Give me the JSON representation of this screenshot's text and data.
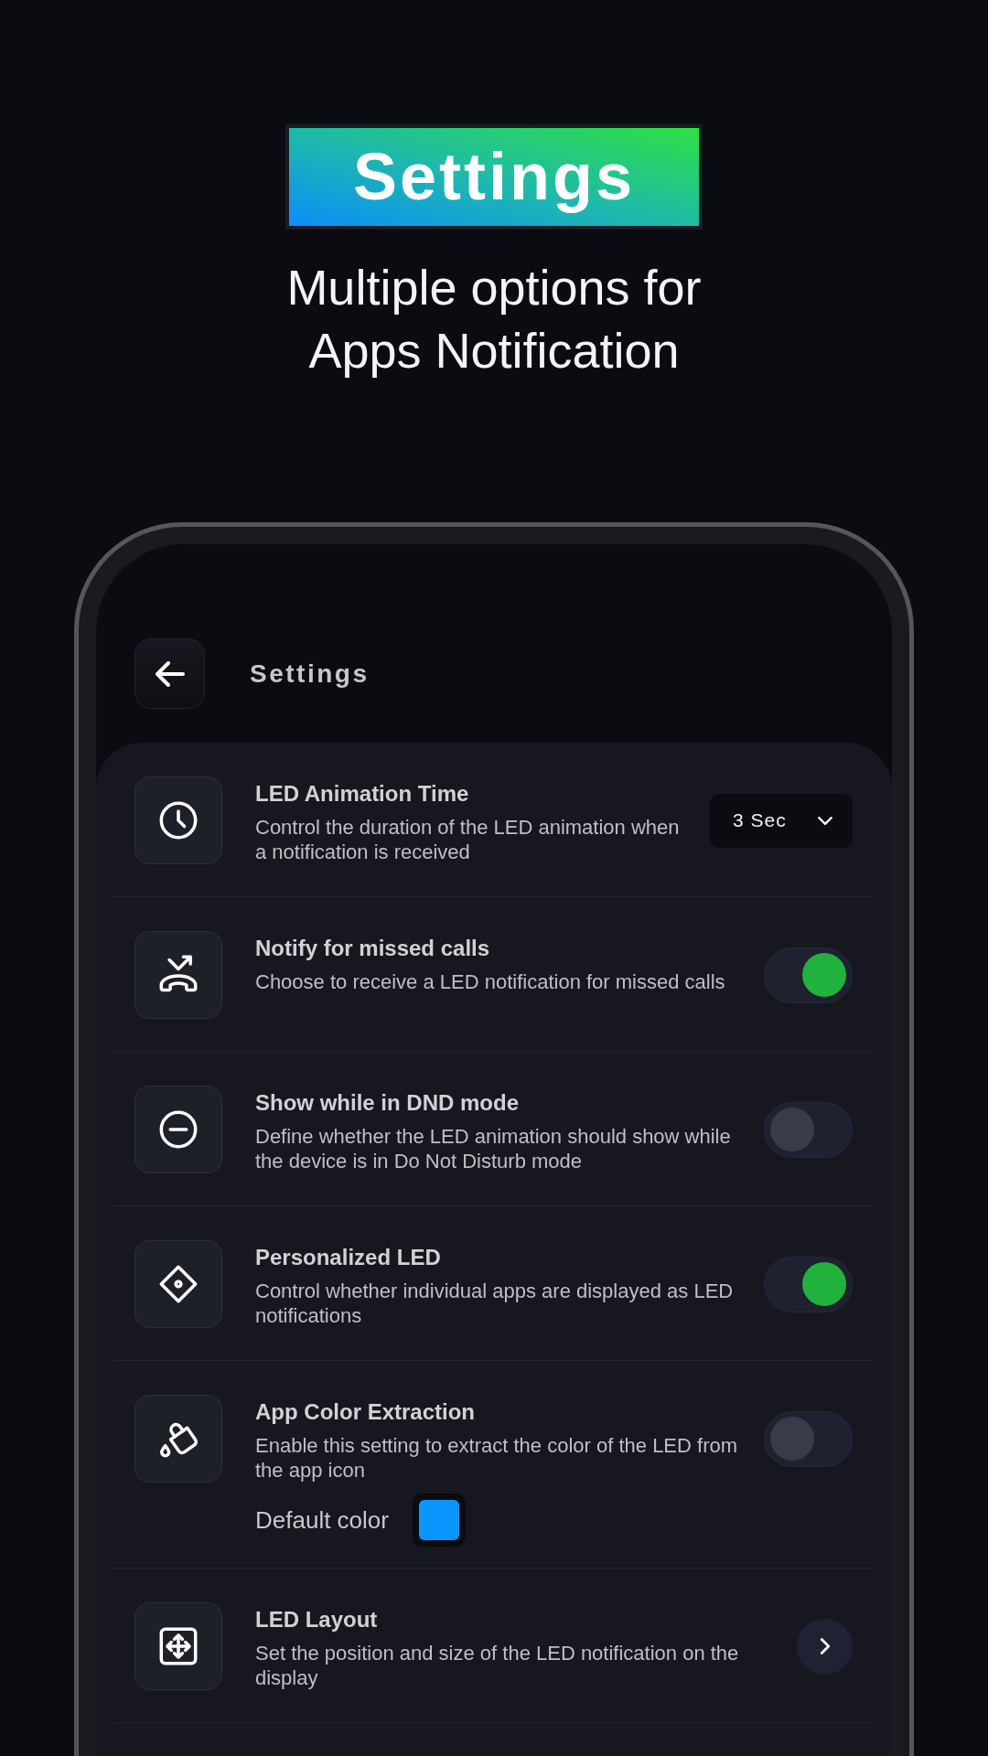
{
  "promo": {
    "badge": "Settings",
    "subtitle": "Multiple options for Apps Notification"
  },
  "app_bar": {
    "title": "Settings"
  },
  "settings": [
    {
      "kind": "dropdown",
      "title": "LED Animation Time",
      "description": "Control the duration of the LED animation when a notification is received",
      "value": "3 Sec"
    },
    {
      "kind": "toggle",
      "title": "Notify for missed calls",
      "description": "Choose to receive a LED notification for missed calls",
      "on": true
    },
    {
      "kind": "toggle",
      "title": "Show while in DND mode",
      "description": "Define whether the LED animation should show while the device is in Do Not Disturb mode",
      "on": false
    },
    {
      "kind": "toggle",
      "title": "Personalized LED",
      "description": "Control whether individual apps are displayed as LED notifications",
      "on": true
    },
    {
      "kind": "toggle",
      "title": "App Color Extraction",
      "description": "Enable this setting to extract the color of the LED from the app icon",
      "on": false,
      "default_color": {
        "label": "Default color",
        "color": "#0a96ff"
      }
    },
    {
      "kind": "link",
      "title": "LED Layout",
      "description": "Set the position and size of the LED notification on the display"
    }
  ]
}
